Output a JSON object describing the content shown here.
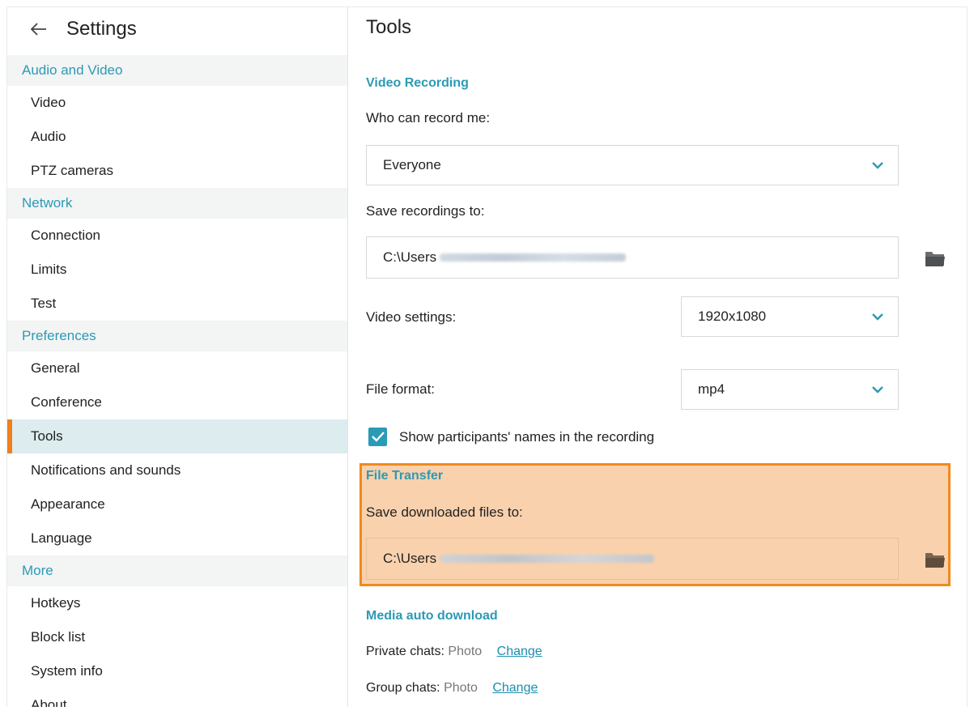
{
  "sidebar": {
    "title": "Settings",
    "sections": [
      {
        "label": "Audio and Video",
        "items": [
          "Video",
          "Audio",
          "PTZ cameras"
        ]
      },
      {
        "label": "Network",
        "items": [
          "Connection",
          "Limits",
          "Test"
        ]
      },
      {
        "label": "Preferences",
        "items": [
          "General",
          "Conference",
          "Tools",
          "Notifications and sounds",
          "Appearance",
          "Language"
        ]
      },
      {
        "label": "More",
        "items": [
          "Hotkeys",
          "Block list",
          "System info",
          "About"
        ]
      }
    ],
    "active_item": "Tools"
  },
  "main": {
    "title": "Tools",
    "video_recording": {
      "heading": "Video Recording",
      "who_label": "Who can record me:",
      "who_value": "Everyone",
      "save_label": "Save recordings to:",
      "save_path_prefix": "C:\\Users",
      "video_settings_label": "Video settings:",
      "video_settings_value": "1920x1080",
      "file_format_label": "File format:",
      "file_format_value": "mp4",
      "show_names_label": "Show participants' names in the recording",
      "show_names_checked": true
    },
    "file_transfer": {
      "heading": "File Transfer",
      "save_label": "Save downloaded files to:",
      "save_path_prefix": "C:\\Users"
    },
    "media_auto_download": {
      "heading": "Media auto download",
      "private_label": "Private chats:",
      "private_value": "Photo",
      "private_link": "Change",
      "group_label": "Group chats:",
      "group_value": "Photo",
      "group_link": "Change"
    }
  },
  "colors": {
    "accent": "#2b9ab5",
    "active_marker": "#f07f1c",
    "highlight_fill": "#f9d1ad",
    "highlight_border": "#f08a1f"
  }
}
